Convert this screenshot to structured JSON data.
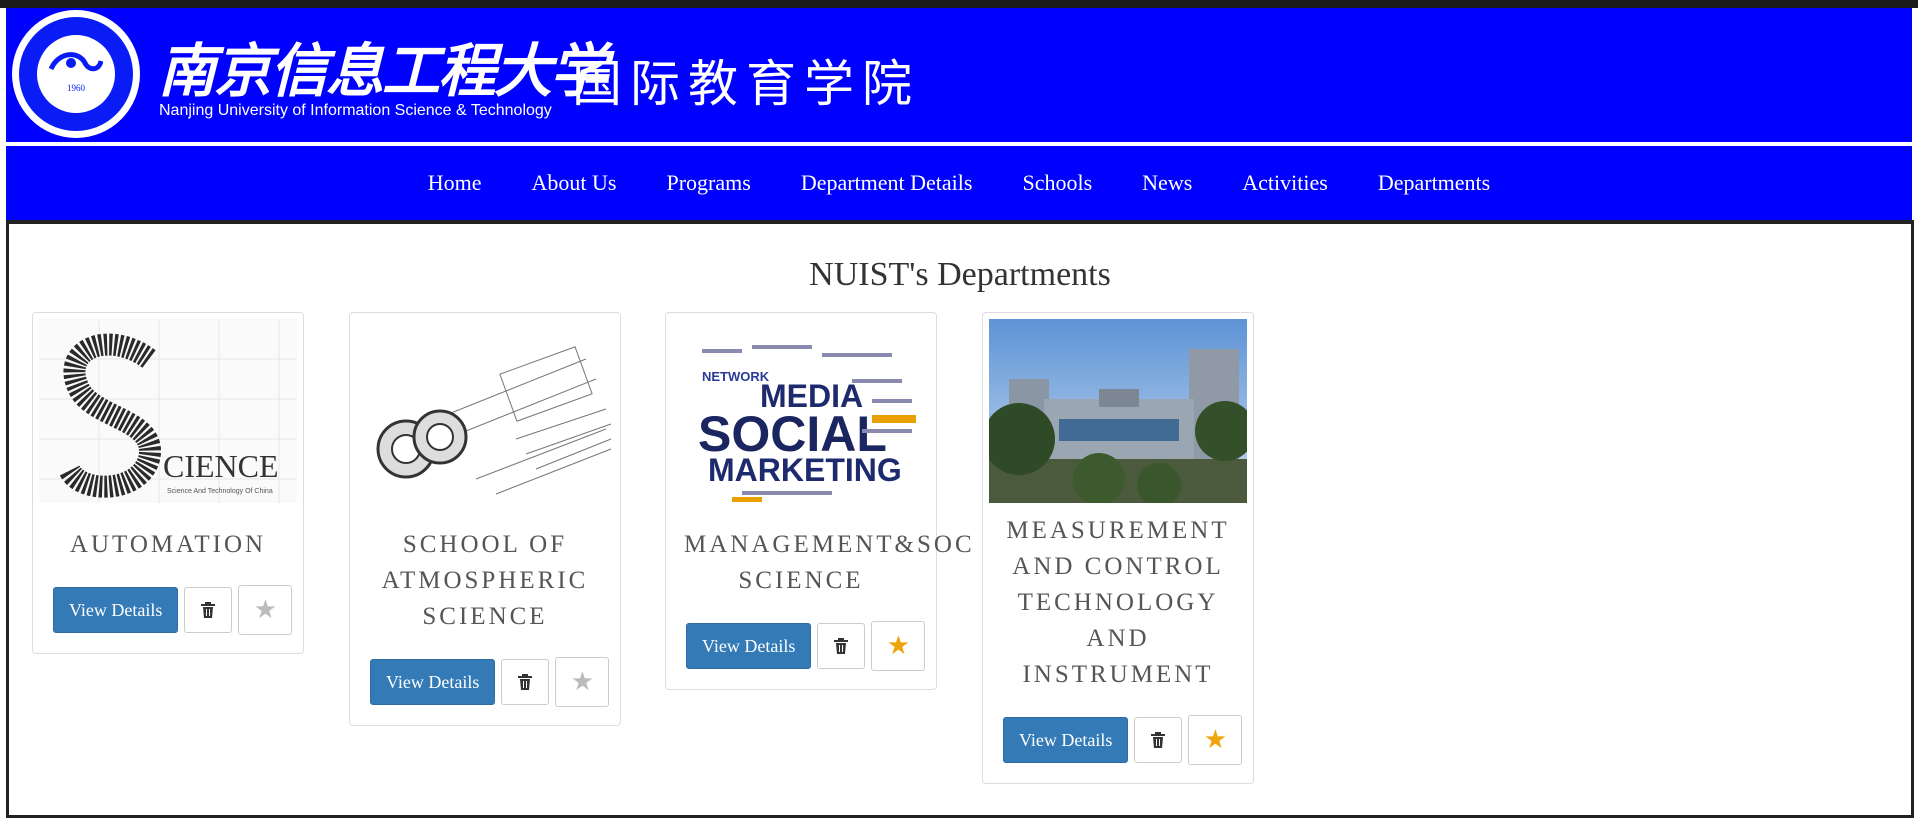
{
  "header": {
    "seal_year": "1960",
    "university_name_zh": "南京信息工程大学",
    "university_name_en": "Nanjing University of Information Science & Technology",
    "college_name_zh": "国际教育学院"
  },
  "nav": {
    "items": [
      "Home",
      "About Us",
      "Programs",
      "Department Details",
      "Schools",
      "News",
      "Activities",
      "Departments"
    ]
  },
  "main": {
    "title": "NUIST's Departments",
    "cards": [
      {
        "title_lines": [
          "AUTOMATION"
        ],
        "image_text": "CIENCE",
        "image_caption": "Science And Technology Of China",
        "view_label": "View Details",
        "starred": false
      },
      {
        "title_lines": [
          "SCHOOL OF",
          "ATMOSPHERIC",
          "SCIENCE"
        ],
        "view_label": "View Details",
        "starred": false
      },
      {
        "title_lines": [
          "MANAGEMENT&SOC",
          "SCIENCE"
        ],
        "image_words": [
          "MEDIA",
          "SOCIAL",
          "MARKETING",
          "NETWORK"
        ],
        "view_label": "View Details",
        "starred": true
      },
      {
        "title_lines": [
          "MEASUREMENT",
          "AND CONTROL",
          "TECHNOLOGY",
          "AND",
          "INSTRUMENT"
        ],
        "view_label": "View Details",
        "starred": true
      }
    ]
  },
  "icons": {
    "trash": "trash-icon",
    "star": "star-icon"
  },
  "colors": {
    "banner_blue": "#0000ff",
    "button_blue": "#337ab7",
    "star_active": "#f0a30a",
    "star_inactive": "#bbbbbb"
  }
}
